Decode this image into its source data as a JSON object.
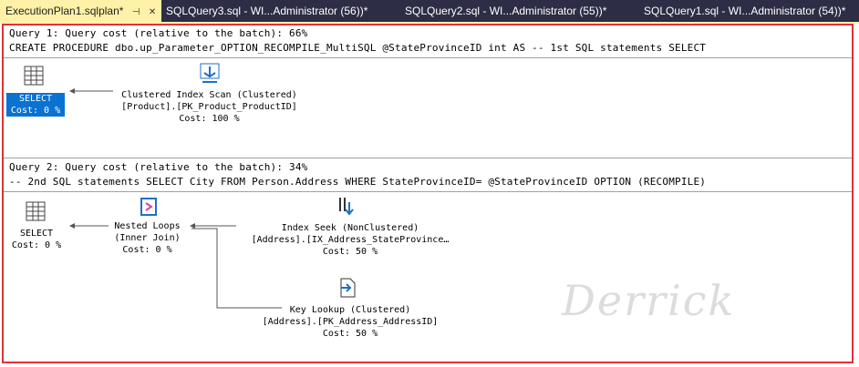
{
  "tabs": [
    {
      "label": "ExecutionPlan1.sqlplan*",
      "active": true
    },
    {
      "label": "SQLQuery3.sql - WI...Administrator (56))*",
      "active": false
    },
    {
      "label": "SQLQuery2.sql - WI...Administrator (55))*",
      "active": false
    },
    {
      "label": "SQLQuery1.sql - WI...Administrator (54))*",
      "active": false
    }
  ],
  "tab_controls": {
    "pin": "⊣",
    "close": "✕"
  },
  "query1": {
    "header": "Query 1: Query cost (relative to the batch): 66%",
    "sql": "CREATE PROCEDURE dbo.up_Parameter_OPTION_RECOMPILE_MultiSQL @StateProvinceID int AS -- 1st SQL statements SELECT",
    "select": {
      "label": "SELECT",
      "cost": "Cost: 0 %"
    },
    "scan": {
      "line1": "Clustered Index Scan (Clustered)",
      "line2": "[Product].[PK_Product_ProductID]",
      "cost": "Cost: 100 %"
    }
  },
  "query2": {
    "header": "Query 2: Query cost (relative to the batch): 34%",
    "sql": "-- 2nd SQL statements SELECT City FROM Person.Address WHERE StateProvinceID= @StateProvinceID OPTION (RECOMPILE)",
    "select": {
      "label": "SELECT",
      "cost": "Cost: 0 %"
    },
    "loops": {
      "line1": "Nested Loops",
      "line2": "(Inner Join)",
      "cost": "Cost: 0 %"
    },
    "seek": {
      "line1": "Index Seek (NonClustered)",
      "line2": "[Address].[IX_Address_StateProvince…",
      "cost": "Cost: 50 %"
    },
    "lookup": {
      "line1": "Key Lookup (Clustered)",
      "line2": "[Address].[PK_Address_AddressID]",
      "cost": "Cost: 50 %"
    }
  },
  "watermark": "Derrick",
  "colors": {
    "tab_bg": "#2d2d45",
    "active_tab": "#fff1a8",
    "highlight": "#e0313a",
    "selected": "#0a72d1"
  }
}
